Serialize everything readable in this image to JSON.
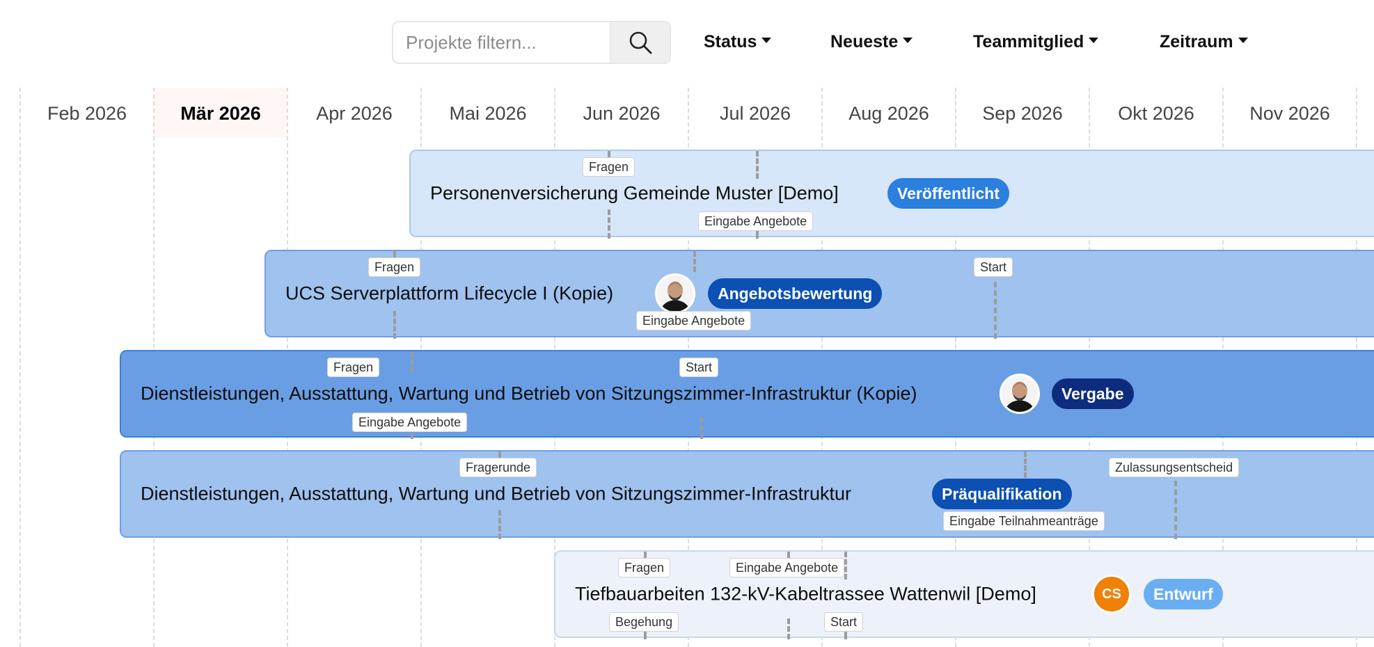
{
  "toolbar": {
    "search_placeholder": "Projekte filtern...",
    "filters": [
      {
        "label": "Status"
      },
      {
        "label": "Neueste"
      },
      {
        "label": "Teammitglied"
      },
      {
        "label": "Zeitraum"
      }
    ]
  },
  "timeline": {
    "months": [
      "Feb 2026",
      "Mär 2026",
      "Apr 2026",
      "Mai 2026",
      "Jun 2026",
      "Jul 2026",
      "Aug 2026",
      "Sep 2026",
      "Okt 2026",
      "Nov 2026"
    ],
    "current_month": "Mär 2026"
  },
  "projects": [
    {
      "title": "Personenversicherung Gemeinde Muster [Demo]",
      "status": "Veröffentlicht",
      "status_color": "#2b7fdf",
      "bar_color": "#d7e6f8",
      "milestones": [
        "Fragen",
        "Eingabe Angebote"
      ]
    },
    {
      "title": "UCS Serverplattform Lifecycle I (Kopie)",
      "status": "Angebotsbewertung",
      "status_color": "#0b50b2",
      "bar_color": "#9fc2ef",
      "avatar": "photo",
      "milestones": [
        "Fragen",
        "Eingabe Angebote",
        "Start"
      ]
    },
    {
      "title": "Dienstleistungen, Ausstattung, Wartung und Betrieb von Sitzungszimmer-Infrastruktur (Kopie)",
      "status": "Vergabe",
      "status_color": "#0d2c7e",
      "bar_color": "#6a9ee4",
      "avatar": "photo",
      "milestones": [
        "Fragen",
        "Eingabe Angebote",
        "Start"
      ]
    },
    {
      "title": "Dienstleistungen, Ausstattung, Wartung und Betrieb von Sitzungszimmer-Infrastruktur",
      "status": "Präqualifikation",
      "status_color": "#0b50b2",
      "bar_color": "#9fc2ef",
      "milestones": [
        "Fragerunde",
        "Eingabe Teilnahmeanträge",
        "Zulassungsentscheid"
      ]
    },
    {
      "title": "Tiefbauarbeiten 132-kV-Kabeltrassee Wattenwil [Demo]",
      "status": "Entwurf",
      "status_color": "#6aaef2",
      "bar_color": "#edf2fa",
      "avatar_initials": "CS",
      "avatar_color": "#ee8106",
      "milestones": [
        "Fragen",
        "Eingabe Angebote",
        "Begehung",
        "Start"
      ]
    }
  ]
}
